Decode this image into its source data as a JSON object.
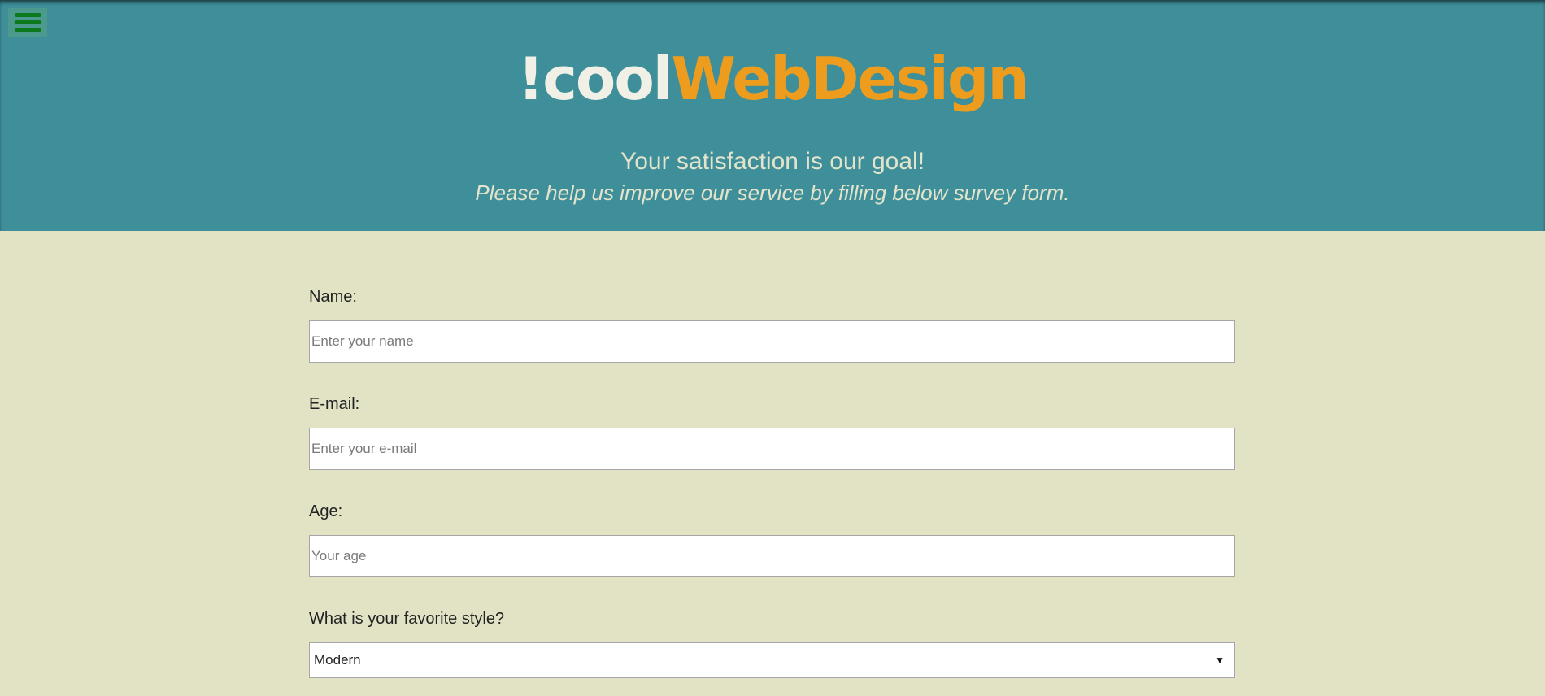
{
  "header": {
    "menu_icon": "hamburger-menu-icon",
    "logo_part1": "!cool",
    "logo_part2": "WebDesign",
    "tagline": "Your satisfaction is our goal!",
    "subline": "Please help us improve our service by filling below survey form."
  },
  "form": {
    "name": {
      "label": "Name:",
      "placeholder": "Enter your name",
      "value": ""
    },
    "email": {
      "label": "E-mail:",
      "placeholder": "Enter your e-mail",
      "value": ""
    },
    "age": {
      "label": "Age:",
      "placeholder": "Your age",
      "value": ""
    },
    "style": {
      "label": "What is your favorite style?",
      "selected": "Modern",
      "arrow": "▼"
    }
  },
  "colors": {
    "header_bg": "#3e8f99",
    "page_bg": "#e2e2c4",
    "logo_light": "#f1f0e6",
    "logo_accent": "#ee9c1e",
    "menu_icon": "#0b7a1c"
  }
}
